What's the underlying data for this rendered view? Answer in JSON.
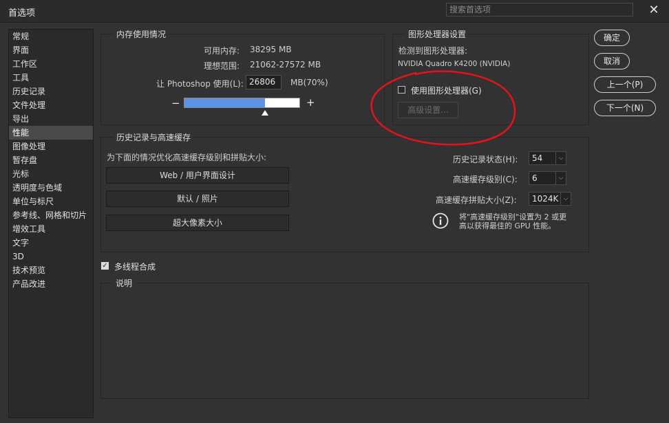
{
  "window": {
    "title": "首选项",
    "close_glyph": "✕"
  },
  "search": {
    "placeholder": "搜索首选项"
  },
  "sidebar": {
    "items": [
      {
        "label": "常规"
      },
      {
        "label": "界面"
      },
      {
        "label": "工作区"
      },
      {
        "label": "工具"
      },
      {
        "label": "历史记录"
      },
      {
        "label": "文件处理"
      },
      {
        "label": "导出"
      },
      {
        "label": "性能"
      },
      {
        "label": "图像处理"
      },
      {
        "label": "暂存盘"
      },
      {
        "label": "光标"
      },
      {
        "label": "透明度与色域"
      },
      {
        "label": "单位与标尺"
      },
      {
        "label": "参考线、网格和切片"
      },
      {
        "label": "增效工具"
      },
      {
        "label": "文字"
      },
      {
        "label": "3D"
      },
      {
        "label": "技术预览"
      },
      {
        "label": "产品改进"
      }
    ],
    "selected_index": 7
  },
  "memory": {
    "title": "内存使用情况",
    "available_label": "可用内存:",
    "available_value": "38295 MB",
    "ideal_label": "理想范围:",
    "ideal_value": "21062-27572 MB",
    "let_label": "让 Photoshop 使用(L):",
    "let_value": "26806",
    "let_unit": "MB(70%)",
    "minus": "−",
    "plus": "+",
    "slider_percent": 70
  },
  "gpu": {
    "title": "图形处理器设置",
    "detected_label": "检测到图形处理器:",
    "detected_value": "NVIDIA Quadro K4200 (NVIDIA)",
    "use_gpu_label": "使用图形处理器(G)",
    "use_gpu_checked": false,
    "advanced_label": "高级设置..."
  },
  "buttons": {
    "ok": "确定",
    "cancel": "取消",
    "prev": "上一个(P)",
    "next": "下一个(N)"
  },
  "history": {
    "title": "历史记录与高速缓存",
    "optimize_label": "为下面的情况优化高速缓存级别和拼贴大小:",
    "preset1": "Web / 用户界面设计",
    "preset2": "默认 / 照片",
    "preset3": "超大像素大小",
    "states_label": "历史记录状态(H):",
    "states_value": "54",
    "levels_label": "高速缓存级别(C):",
    "levels_value": "6",
    "tile_label": "高速缓存拼贴大小(Z):",
    "tile_value": "1024K",
    "note_line1": "将\"高速缓存级别\"设置为 2 或更",
    "note_line2": "高以获得最佳的 GPU 性能。"
  },
  "multithread": {
    "label": "多线程合成",
    "checked": true
  },
  "description": {
    "title": "说明"
  },
  "colors": {
    "annotation_red": "#e0141a",
    "slider_fill": "#5b93e6",
    "background": "#323232"
  },
  "icons": {
    "info": "info-icon",
    "close": "close-icon",
    "checkbox": "checkbox-icon",
    "dropdown": "chevron-down-icon"
  }
}
